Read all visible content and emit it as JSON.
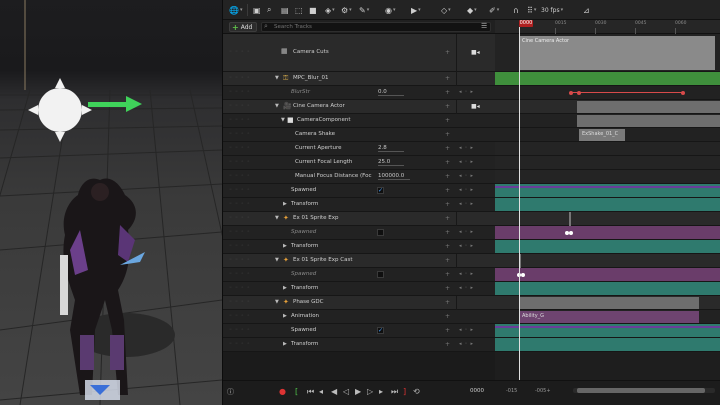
{
  "toolbar": {
    "fps": "30 fps",
    "frame_badge": "0000"
  },
  "track_header": {
    "add_label": "Add",
    "search_placeholder": "Search Tracks"
  },
  "tracks": {
    "camera_cuts": "Camera Cuts",
    "mpc_blur": "MPC_Blur_01",
    "blur_str": "BlurStr",
    "blur_str_value": "0.0",
    "cine_camera_actor": "Cine Camera Actor",
    "camera_component": "CameraComponent",
    "camera_shake": "Camera Shake",
    "current_aperture": "Current Aperture",
    "current_aperture_value": "2.8",
    "current_focal_length": "Current Focal Length",
    "current_focal_length_value": "25.0",
    "manual_focus_distance": "Manual Focus Distance (Foc",
    "manual_focus_distance_value": "100000.0",
    "spawned": "Spawned",
    "transform": "Transform",
    "ex01_sprite_exp": "Ex 01 Sprite Exp",
    "ex01_sprite_exp_cast": "Ex 01 Sprite Exp Cast",
    "phase_gdc": "Phase GDC",
    "animation": "Animation"
  },
  "timeline": {
    "ruler_labels": [
      "0000",
      "0015",
      "0030",
      "0045",
      "0060"
    ],
    "clip_cine_camera": "Cine Camera Actor",
    "clip_shake": "ExShake_01_C",
    "clip_ability": "Ability_G"
  },
  "bottom": {
    "frame": "0000",
    "range_start": "-015",
    "range_mid": "-005+"
  },
  "colors": {
    "accent_green": "#4fa84a",
    "key_red": "#d84a4a",
    "teal_lane": "#2f7a6e",
    "purple_lane": "#6a3d6a"
  }
}
